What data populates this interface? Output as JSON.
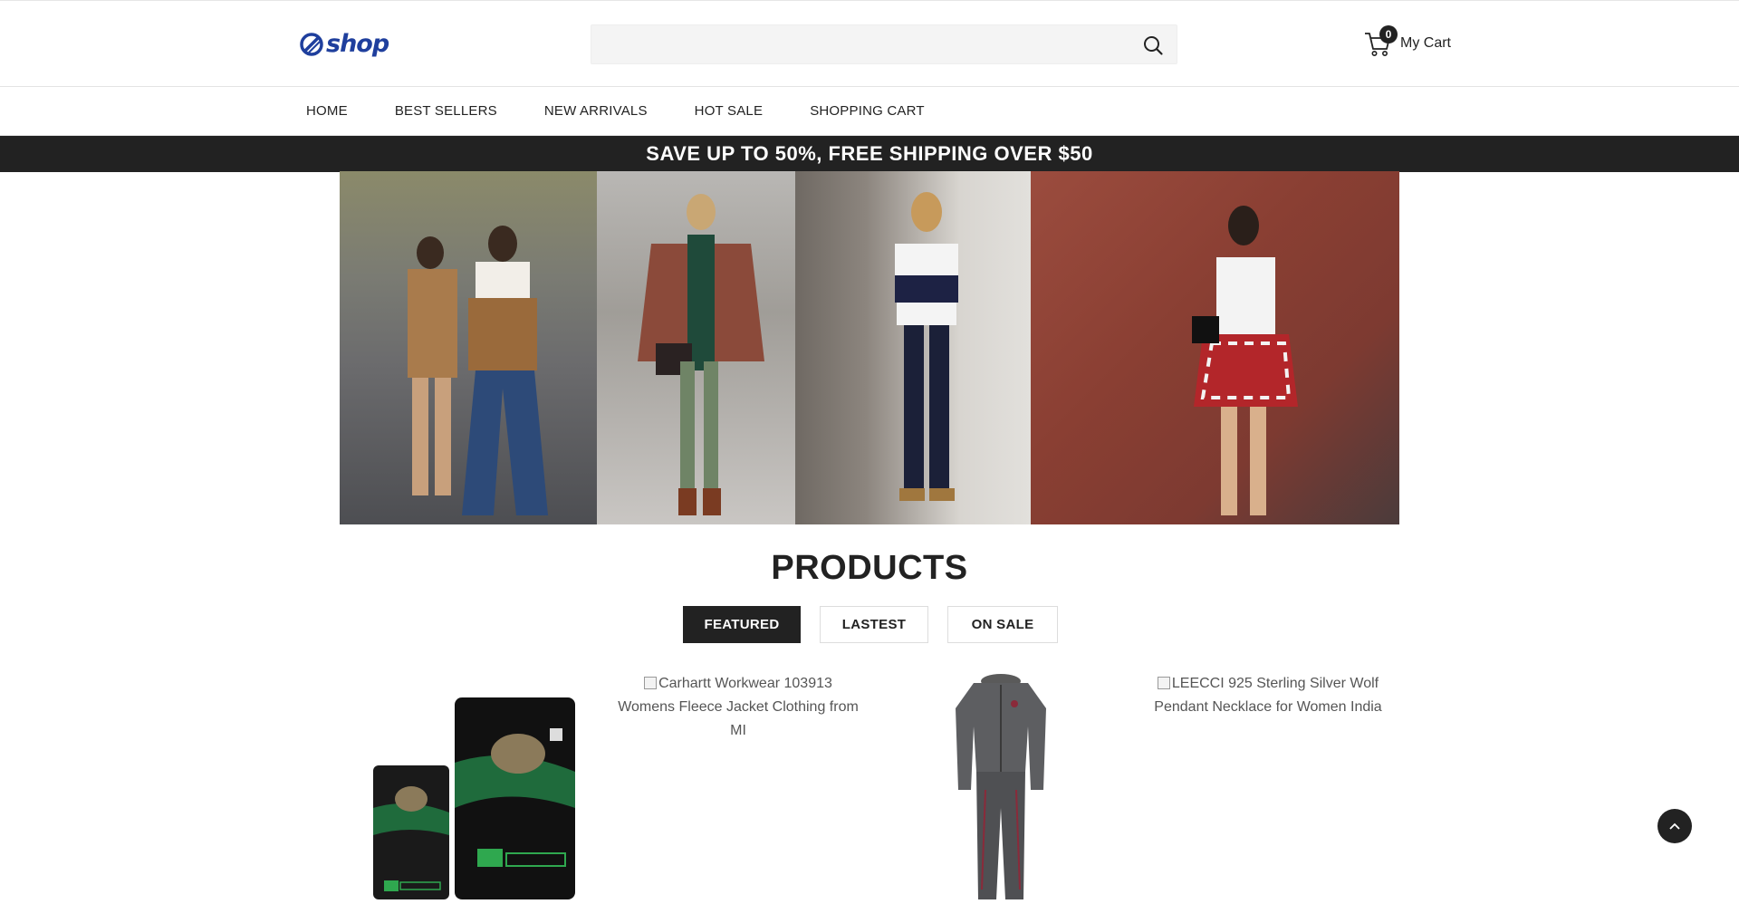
{
  "header": {
    "logo_text": "shop",
    "search": {
      "placeholder": "",
      "value": ""
    },
    "cart": {
      "count": "0",
      "label": "My Cart"
    }
  },
  "nav": {
    "items": [
      "HOME",
      "BEST SELLERS",
      "NEW ARRIVALS",
      "HOT SALE",
      "SHOPPING CART"
    ]
  },
  "promo": {
    "text": "SAVE UP TO 50%, FREE SHIPPING OVER $50"
  },
  "products": {
    "title": "PRODUCTS",
    "tabs": [
      {
        "label": "FEATURED",
        "active": true
      },
      {
        "label": "LASTEST",
        "active": false
      },
      {
        "label": "ON SALE",
        "active": false
      }
    ],
    "items": [
      {
        "alt": "",
        "image": "dog-food-bags"
      },
      {
        "alt": "Carhartt Workwear 103913 Womens Fleece Jacket Clothing from MI",
        "image": "broken"
      },
      {
        "alt": "",
        "image": "grey-tracksuit"
      },
      {
        "alt": "LEECCI 925 Sterling Silver Wolf Pendant Necklace for Women India",
        "image": "broken"
      }
    ]
  },
  "colors": {
    "brand": "#1f3f9d",
    "dark": "#222222",
    "promo_bg": "#222222"
  }
}
